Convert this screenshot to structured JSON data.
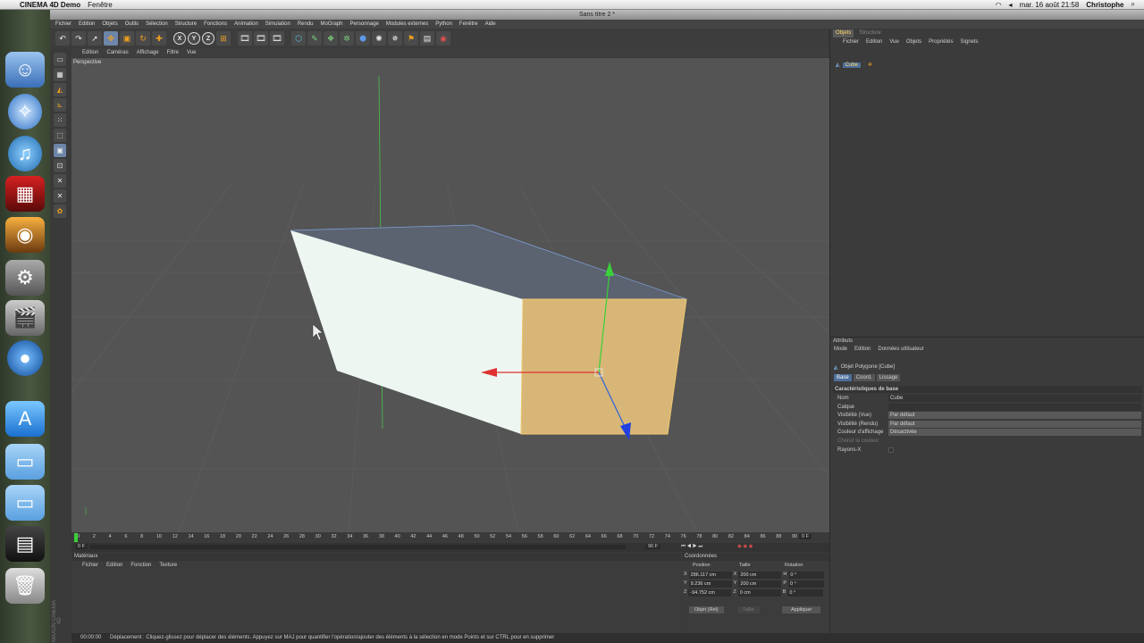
{
  "menubar": {
    "app_name": "CINEMA 4D Demo",
    "items": [
      "Fenêtre"
    ],
    "clock": "mar. 16 août  21:58",
    "user": "Christophe"
  },
  "window": {
    "title": "Sans titre 2 *"
  },
  "main_menu": [
    "Fichier",
    "Edition",
    "Objets",
    "Outils",
    "Sélection",
    "Structure",
    "Fonctions",
    "Animation",
    "Simulation",
    "Rendu",
    "MoGraph",
    "Personnage",
    "Modules externes",
    "Python",
    "Fenêtre",
    "Aide"
  ],
  "toolbar": {
    "axis_x": "X",
    "axis_y": "Y",
    "axis_z": "Z"
  },
  "viewport": {
    "menu": [
      "Edition",
      "Caméras",
      "Affichage",
      "Filtre",
      "Vue"
    ],
    "label": "Perspective"
  },
  "timeline": {
    "ticks": [
      "0",
      "2",
      "4",
      "6",
      "8",
      "10",
      "12",
      "14",
      "16",
      "18",
      "20",
      "22",
      "24",
      "26",
      "28",
      "30",
      "32",
      "34",
      "36",
      "38",
      "40",
      "42",
      "44",
      "46",
      "48",
      "50",
      "52",
      "54",
      "56",
      "58",
      "60",
      "62",
      "64",
      "66",
      "68",
      "70",
      "72",
      "74",
      "76",
      "78",
      "80",
      "82",
      "84",
      "86",
      "88",
      "90"
    ],
    "frame_end_label": "0 F",
    "current_frame": "0 F",
    "max_frame": "90 F"
  },
  "materials": {
    "title": "Matériaux",
    "menu": [
      "Fichier",
      "Edition",
      "Fonction",
      "Texture"
    ]
  },
  "coordinates": {
    "title": "Coordonnées",
    "col_position": "Position",
    "col_size": "Taille",
    "col_rotation": "Rotation",
    "rows": [
      {
        "axis": "X",
        "pos": "286.117 cm",
        "size_axis": "X",
        "size": "200 cm",
        "rot_axis": "H",
        "rot": "0 °"
      },
      {
        "axis": "Y",
        "pos": "9.236 cm",
        "size_axis": "Y",
        "size": "200 cm",
        "rot_axis": "P",
        "rot": "0 °"
      },
      {
        "axis": "Z",
        "pos": "-94.752 cm",
        "size_axis": "Z",
        "size": "0 cm",
        "rot_axis": "B",
        "rot": "0 °"
      }
    ],
    "mode_select": "Objet (Rel)",
    "size_select": "Taille",
    "apply_button": "Appliquer"
  },
  "objects_panel": {
    "tabs": [
      "Objets",
      "Structure"
    ],
    "menu": [
      "Fichier",
      "Edition",
      "Vue",
      "Objets",
      "Propriétés",
      "Signets"
    ],
    "object_name": "Cube"
  },
  "attributes": {
    "title": "Attributs",
    "menu": [
      "Mode",
      "Edition",
      "Données utilisateur"
    ],
    "object_type": "Objet Polygone [Cube]",
    "tabs": [
      "Base",
      "Coord.",
      "Lissage"
    ],
    "section": "Caractéristiques de base",
    "fields": [
      {
        "label": "Nom",
        "value": "Cube"
      },
      {
        "label": "Calque",
        "value": ""
      },
      {
        "label": "Visibilité (Vue)",
        "value": "Par défaut"
      },
      {
        "label": "Visibilité (Rendu)",
        "value": "Par défaut"
      },
      {
        "label": "Couleur d'affichage",
        "value": "Désactivée"
      },
      {
        "label": "Choisir la couleur",
        "value": ""
      },
      {
        "label": "Rayons-X",
        "value": ""
      }
    ]
  },
  "status": {
    "time": "00:00:00",
    "text": "Déplacement : Cliquez-glissez pour déplacer des éléments. Appuyez sur MAJ pour quantifier l'opération/ajouter des éléments à la sélection en mode Points et sur CTRL pour en supprimer"
  },
  "branding": "MAXON CINEMA 4D"
}
